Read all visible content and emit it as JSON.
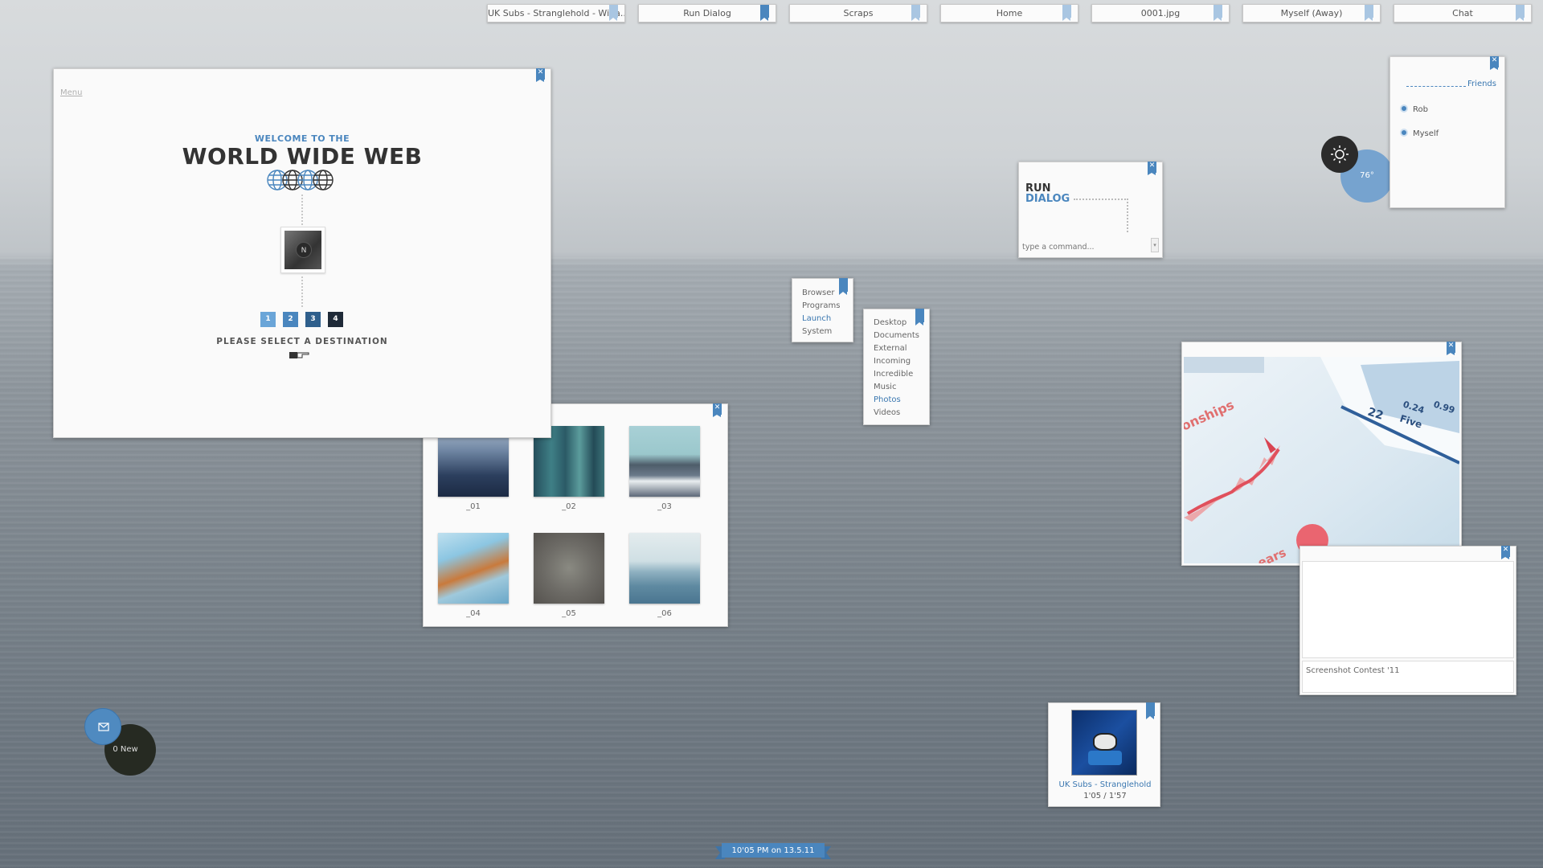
{
  "taskbar": {
    "tabs": [
      {
        "label": "UK Subs - Stranglehold - Wina..."
      },
      {
        "label": "Run Dialog"
      },
      {
        "label": "Scraps"
      },
      {
        "label": "Home"
      },
      {
        "label": "0001.jpg"
      },
      {
        "label": "Myself (Away)"
      },
      {
        "label": "Chat"
      }
    ]
  },
  "colors": {
    "accent": "#4a86be",
    "dark": "#2b2b2b"
  },
  "welcome": {
    "menu": "Menu",
    "subtitle": "WELCOME TO THE",
    "title": "WORLD WIDE WEB",
    "avatar_letter": "N",
    "destinations": [
      "1",
      "2",
      "3",
      "4"
    ],
    "prompt": "PLEASE SELECT A DESTINATION"
  },
  "photos": {
    "labels": [
      "_01",
      "_02",
      "_03",
      "_04",
      "_05",
      "_06"
    ]
  },
  "launch_menu": {
    "items": [
      "Browser",
      "Programs",
      "Launch",
      "System"
    ],
    "active": "Launch"
  },
  "folders_menu": {
    "items": [
      "Desktop",
      "Documents",
      "External",
      "Incoming",
      "Incredible",
      "Music",
      "Photos",
      "Videos"
    ],
    "active": "Photos"
  },
  "run_dialog": {
    "title_line1": "RUN",
    "title_line2": "DIALOG",
    "placeholder": "type a command..."
  },
  "weather": {
    "icon": "sun-icon",
    "temperature": "76°"
  },
  "friends": {
    "header": "Friends",
    "list": [
      "Rob",
      "Myself"
    ]
  },
  "image_viewer": {
    "file": "0001.jpg",
    "image_text": {
      "left_word": "onships",
      "bottom_word": "ears",
      "number1": "22",
      "number2": "0.24",
      "number3": "0.99",
      "word": "Five"
    }
  },
  "scraps": {
    "caption": "Screenshot Contest '11"
  },
  "music": {
    "track": "UK Subs - Stranglehold",
    "position": "1'05 / 1'57"
  },
  "mail": {
    "icon": "mail-icon",
    "count_label": "0 New"
  },
  "clock": {
    "label": "10'05 PM on 13.5.11"
  }
}
